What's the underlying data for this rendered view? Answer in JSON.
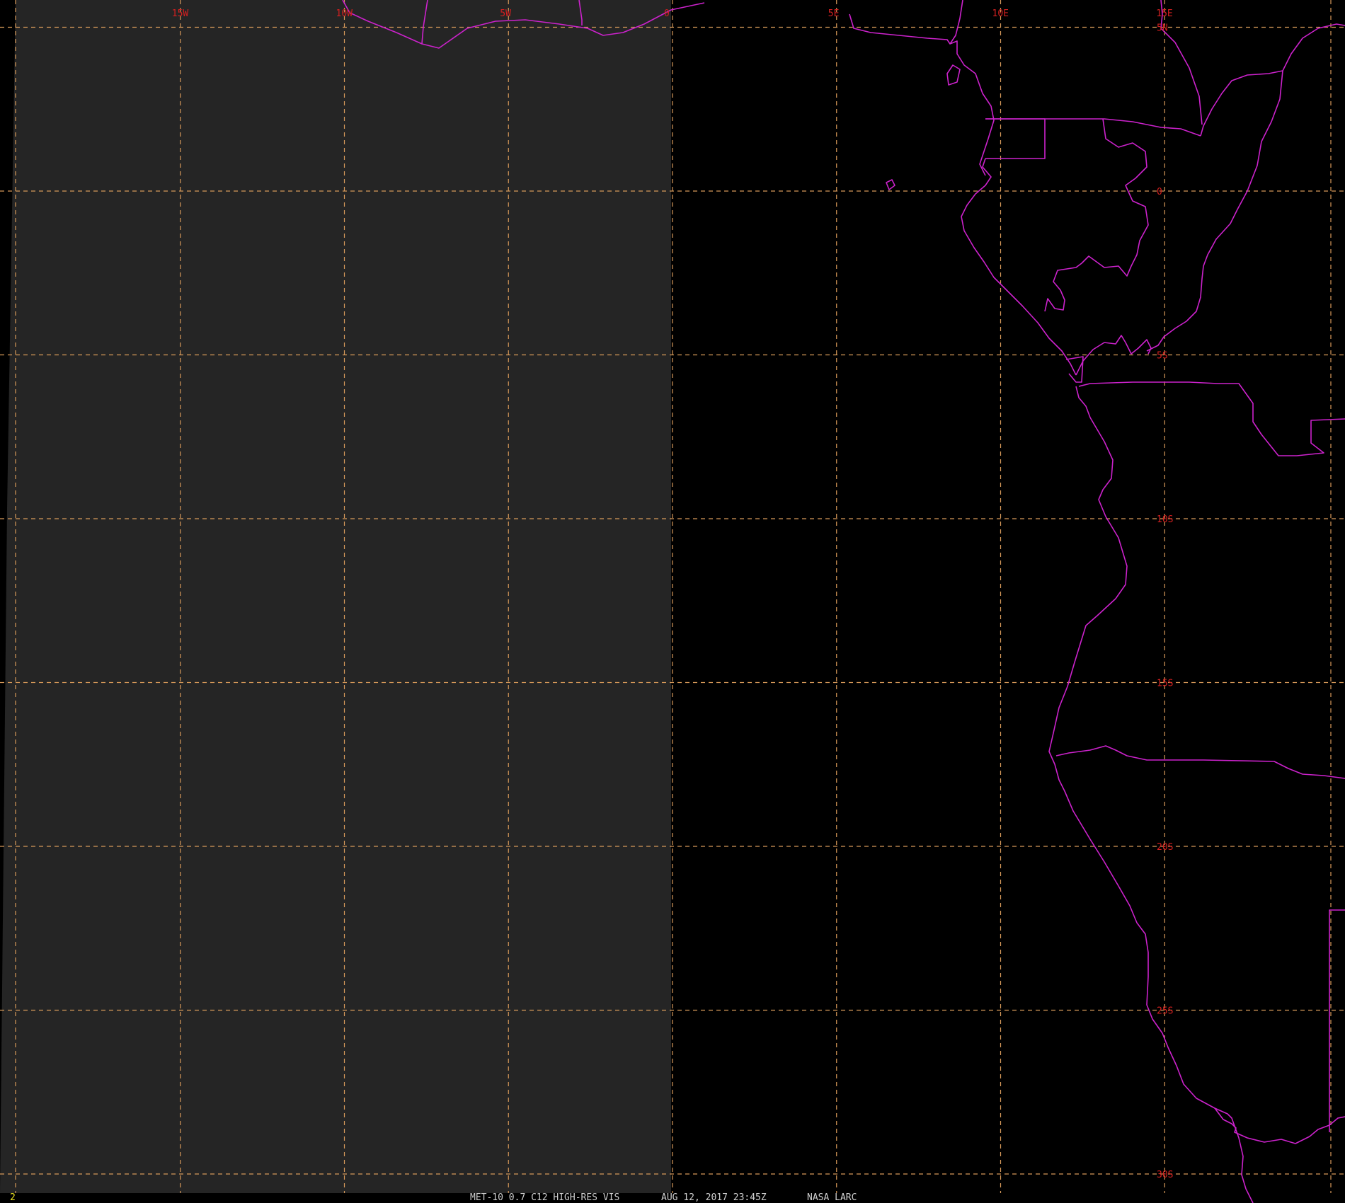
{
  "image": {
    "frame_number": "2",
    "caption": {
      "product": "MET-10 0.7 C12 HIGH-RES VIS",
      "datetime": "AUG 12, 2017 23:45Z",
      "source": "NASA LARC"
    }
  },
  "colors": {
    "background": "#000000",
    "dim_region": "#262626",
    "gridline": "#d89a5a",
    "grid_label": "#d42020",
    "border": "#cc22cc",
    "footer_text": "#d0d0d0",
    "frame_number_text": "#e8e020"
  },
  "map": {
    "projection": "lat-lon",
    "lon_range": [
      -20,
      17.5
    ],
    "lat_range": [
      5.5,
      -30.5
    ],
    "grid_spacing_deg": 5,
    "longitude_labels": [
      {
        "lon": -15,
        "label": "15W"
      },
      {
        "lon": -10,
        "label": "10W"
      },
      {
        "lon": -5,
        "label": "5W"
      },
      {
        "lon": 0,
        "label": "0"
      },
      {
        "lon": 5,
        "label": "5E"
      },
      {
        "lon": 10,
        "label": "10E"
      },
      {
        "lon": 15,
        "label": "15E"
      }
    ],
    "latitude_labels": [
      {
        "lat": 5,
        "label": "5N"
      },
      {
        "lat": 0,
        "label": "0"
      },
      {
        "lat": -5,
        "label": "5S"
      },
      {
        "lat": -10,
        "label": "10S"
      },
      {
        "lat": -15,
        "label": "15S"
      },
      {
        "lat": -20,
        "label": "20S"
      },
      {
        "lat": -25,
        "label": "25S"
      },
      {
        "lat": -30,
        "label": "30S"
      }
    ],
    "night_dim_region_east_edge_lon": 0
  }
}
